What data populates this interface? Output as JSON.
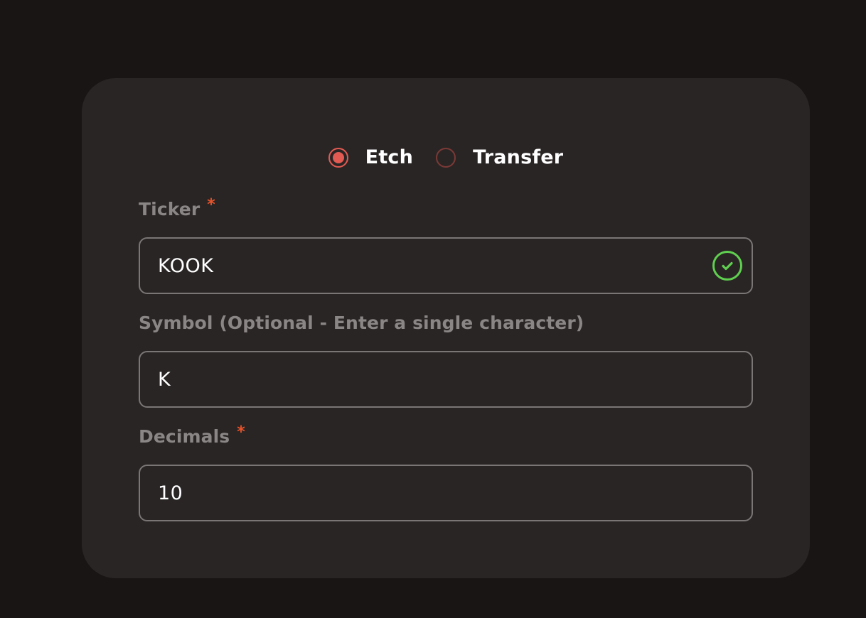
{
  "mode_selector": {
    "options": [
      {
        "label": "Etch",
        "checked": true
      },
      {
        "label": "Transfer",
        "checked": false
      }
    ]
  },
  "fields": {
    "ticker": {
      "label": "Ticker",
      "required_mark": "*",
      "value": "KOOK",
      "status_icon": "check-circle-icon",
      "status_color": "#5fcf4f"
    },
    "symbol": {
      "label": "Symbol (Optional - Enter a single character)",
      "value": "K"
    },
    "decimals": {
      "label": "Decimals",
      "required_mark": "*",
      "value": "10"
    }
  },
  "colors": {
    "accent": "#e25a52",
    "required": "#e8542b",
    "valid": "#5fcf4f"
  }
}
